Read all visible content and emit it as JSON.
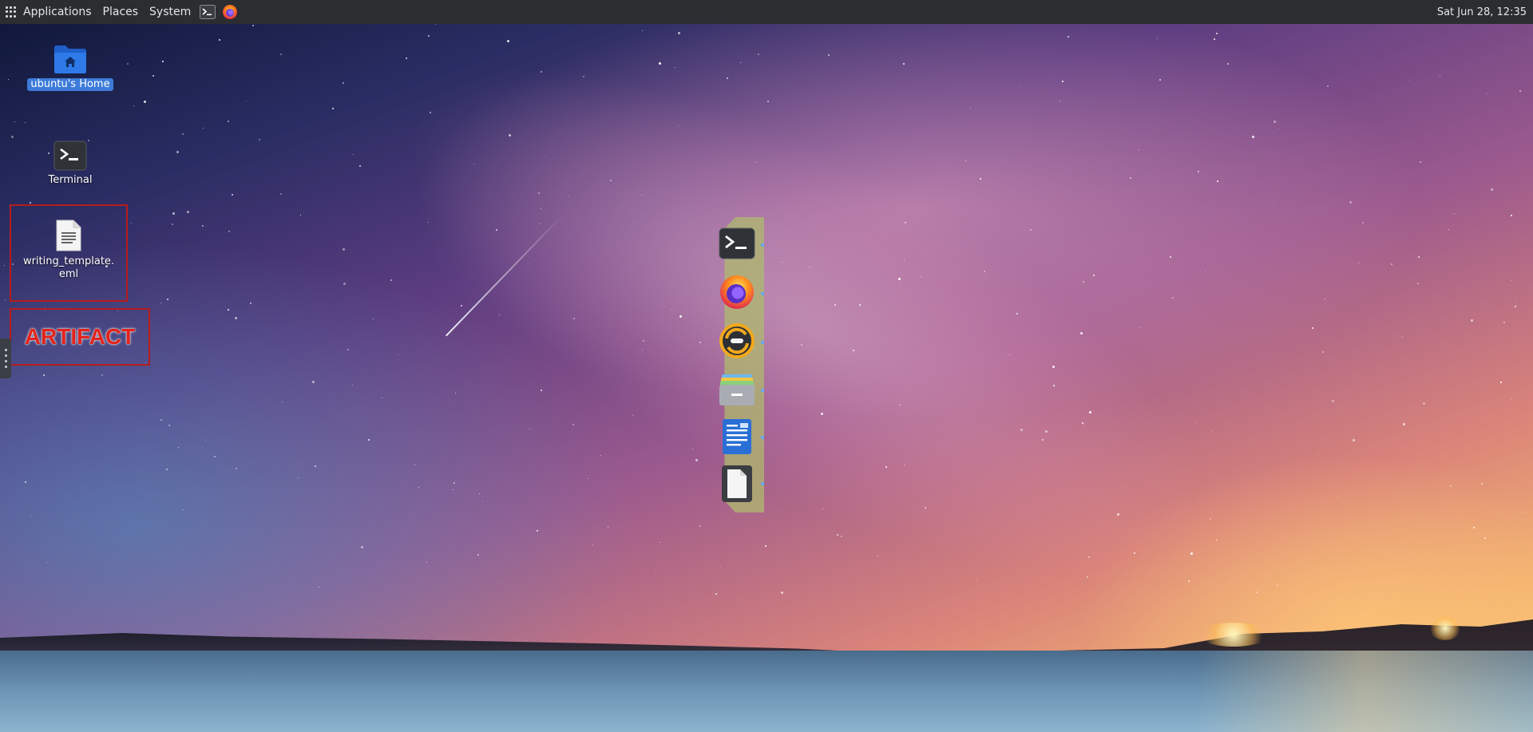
{
  "panel": {
    "menus": [
      "Applications",
      "Places",
      "System"
    ],
    "launchers": [
      "terminal-icon",
      "firefox-icon"
    ],
    "clock": "Sat Jun 28, 12:35"
  },
  "desktop": {
    "icons": [
      {
        "label": "ubuntu's Home",
        "icon": "home-folder-icon",
        "selected": true
      },
      {
        "label": "Terminal",
        "icon": "terminal-icon"
      },
      {
        "label": "writing_template.\neml",
        "icon": "text-file-icon"
      }
    ],
    "overlay_text": "ARTIFACT"
  },
  "dock": {
    "items": [
      {
        "icon": "terminal-icon"
      },
      {
        "icon": "firefox-icon"
      },
      {
        "icon": "update-sync-icon"
      },
      {
        "icon": "file-manager-icon"
      },
      {
        "icon": "text-editor-icon"
      },
      {
        "icon": "blank-document-icon"
      }
    ]
  },
  "colors": {
    "panel_bg": "#2b2d30",
    "selection": "#3d7bd9",
    "artifact_red": "#e2231a",
    "dock_bg": "#afb96e"
  }
}
